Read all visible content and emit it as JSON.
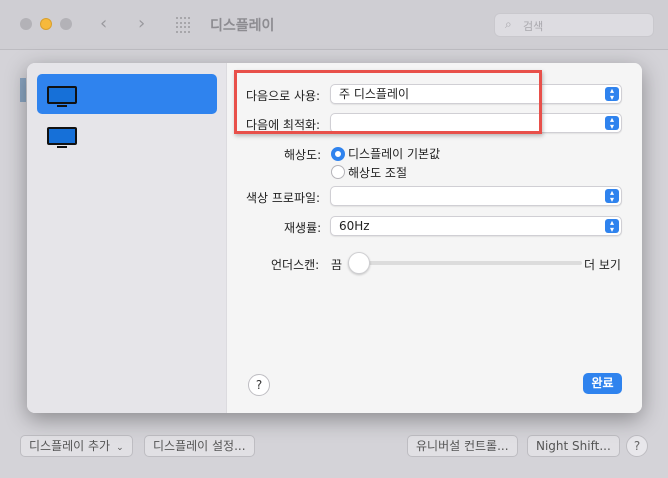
{
  "window": {
    "title": "디스플레이",
    "search_placeholder": "검색",
    "icons": {
      "back": "chevron-left-icon",
      "forward": "chevron-right-icon",
      "grid": "grid-icon",
      "search": "search-icon"
    }
  },
  "bottom_bar": {
    "add_display": "디스플레이 추가",
    "display_settings": "디스플레이 설정...",
    "universal_control": "유니버설 컨트롤...",
    "night_shift": "Night Shift...",
    "help": "?"
  },
  "sheet": {
    "displays": [
      {
        "selected": true,
        "icon": "monitor-icon"
      },
      {
        "selected": false,
        "icon": "monitor-icon"
      }
    ],
    "use_as": {
      "label": "다음으로 사용:",
      "value": "주 디스플레이"
    },
    "optimize_for": {
      "label": "다음에 최적화:",
      "value": ""
    },
    "resolution": {
      "label": "해상도:",
      "options": [
        {
          "label": "디스플레이 기본값",
          "checked": true
        },
        {
          "label": "해상도 조절",
          "checked": false
        }
      ]
    },
    "color_profile": {
      "label": "색상 프로파일:",
      "value": ""
    },
    "refresh_rate": {
      "label": "재생률:",
      "value": "60Hz"
    },
    "underscan": {
      "label": "언더스캔:",
      "min_label": "끔",
      "max_label": "더 보기",
      "value": 0
    },
    "help": "?",
    "done": "완료"
  },
  "colors": {
    "accent": "#2f83ee",
    "highlight_box": "#e8504a"
  }
}
